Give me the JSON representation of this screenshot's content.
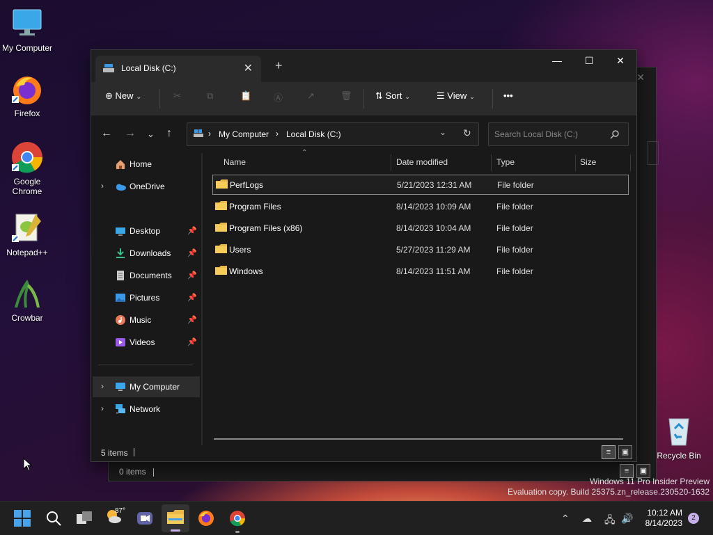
{
  "desktop": {
    "icons": [
      {
        "label": "My Computer",
        "icon": "monitor-icon"
      },
      {
        "label": "Firefox",
        "icon": "firefox-icon"
      },
      {
        "label": "Google Chrome",
        "icon": "chrome-icon"
      },
      {
        "label": "Notepad++",
        "icon": "notepadpp-icon"
      },
      {
        "label": "Crowbar",
        "icon": "crowbar-icon"
      },
      {
        "label": "Recycle Bin",
        "icon": "recycle-bin-icon"
      }
    ]
  },
  "back_window": {
    "status_count": "0 items"
  },
  "window": {
    "tab_title": "Local Disk (C:)",
    "new_tab": "+",
    "controls": {
      "minimize": "—",
      "maximize": "☐",
      "close": "✕"
    },
    "toolbar": {
      "new_label": "New",
      "sort_label": "Sort",
      "view_label": "View",
      "more_label": "•••"
    },
    "address": {
      "crumbs": [
        "My Computer",
        "Local Disk (C:)"
      ],
      "search_placeholder": "Search Local Disk (C:)"
    },
    "sidebar": {
      "home": "Home",
      "onedrive": "OneDrive",
      "quick": [
        {
          "label": "Desktop",
          "icon": "desktop-folder-icon"
        },
        {
          "label": "Downloads",
          "icon": "downloads-icon"
        },
        {
          "label": "Documents",
          "icon": "documents-icon"
        },
        {
          "label": "Pictures",
          "icon": "pictures-icon"
        },
        {
          "label": "Music",
          "icon": "music-icon"
        },
        {
          "label": "Videos",
          "icon": "videos-icon"
        }
      ],
      "my_computer": "My Computer",
      "network": "Network"
    },
    "columns": {
      "name": "Name",
      "date": "Date modified",
      "type": "Type",
      "size": "Size"
    },
    "files": [
      {
        "name": "PerfLogs",
        "date": "5/21/2023 12:31 AM",
        "type": "File folder"
      },
      {
        "name": "Program Files",
        "date": "8/14/2023 10:09 AM",
        "type": "File folder"
      },
      {
        "name": "Program Files (x86)",
        "date": "8/14/2023 10:04 AM",
        "type": "File folder"
      },
      {
        "name": "Users",
        "date": "5/27/2023 11:29 AM",
        "type": "File folder"
      },
      {
        "name": "Windows",
        "date": "8/14/2023 11:51 AM",
        "type": "File folder"
      }
    ],
    "status_count": "5 items"
  },
  "watermark": {
    "line1": "Windows 11 Pro Insider Preview",
    "line2": "Evaluation copy. Build 25375.zn_release.230520-1632"
  },
  "taskbar": {
    "weather_temp": "87°",
    "time": "10:12 AM",
    "date": "8/14/2023",
    "notifications": "2"
  },
  "colors": {
    "folder": "#e8b84a",
    "accent": "#4aa3e8"
  }
}
